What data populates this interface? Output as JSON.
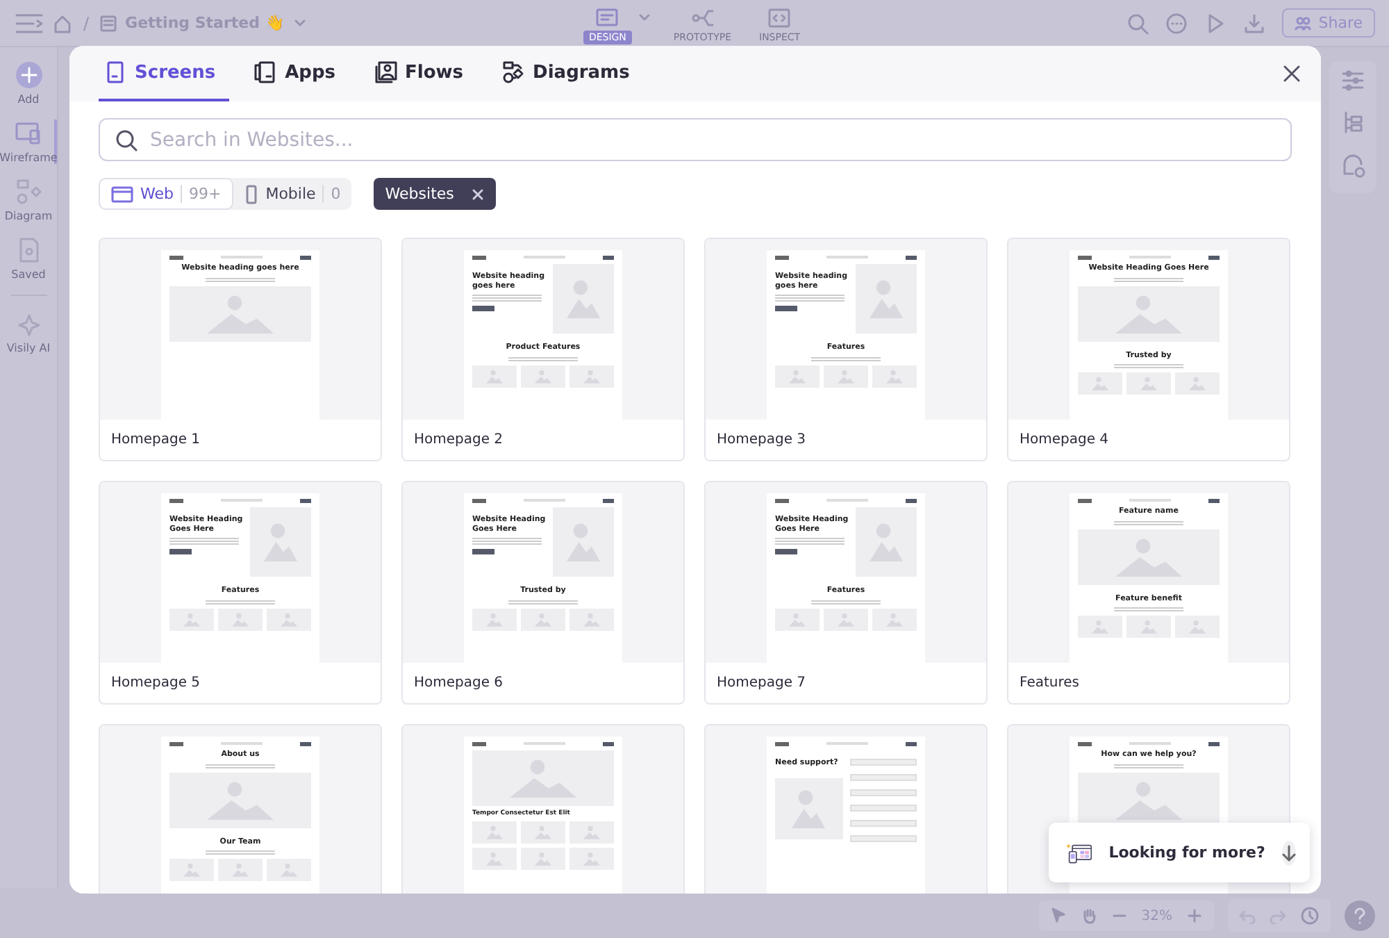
{
  "app": {
    "breadcrumb_separator": "/",
    "breadcrumb": "Getting Started 👋",
    "modes": [
      {
        "label": "DESIGN",
        "selected": true
      },
      {
        "label": "PROTOTYPE",
        "selected": false
      },
      {
        "label": "INSPECT",
        "selected": false
      }
    ],
    "share": "Share",
    "sidebar": [
      {
        "label": "Add",
        "kind": "add",
        "selected": false
      },
      {
        "label": "Wireframe",
        "kind": "wireframe",
        "selected": true
      },
      {
        "label": "Diagram",
        "kind": "diagram",
        "selected": false
      },
      {
        "label": "Saved",
        "kind": "saved",
        "selected": false
      },
      {
        "label": "Visily AI",
        "kind": "ai",
        "selected": false
      }
    ],
    "zoom": "32%"
  },
  "modal": {
    "tabs": [
      {
        "label": "Screens",
        "selected": true
      },
      {
        "label": "Apps",
        "selected": false
      },
      {
        "label": "Flows",
        "selected": false
      },
      {
        "label": "Diagrams",
        "selected": false
      }
    ],
    "search": {
      "placeholder": "Search in Websites..."
    },
    "platforms": [
      {
        "label": "Web",
        "count": "99+",
        "selected": true
      },
      {
        "label": "Mobile",
        "count": "0",
        "selected": false
      }
    ],
    "filter": {
      "label": "Websites"
    },
    "templates": [
      {
        "name": "Homepage 1",
        "kind": "center",
        "headings": [
          "Website heading goes here"
        ]
      },
      {
        "name": "Homepage 2",
        "kind": "split",
        "headings": [
          "Website heading goes here",
          "Product Features"
        ]
      },
      {
        "name": "Homepage 3",
        "kind": "split",
        "headings": [
          "Website heading goes here",
          "Features"
        ]
      },
      {
        "name": "Homepage 4",
        "kind": "center",
        "headings": [
          "Website Heading Goes Here",
          "Trusted by"
        ]
      },
      {
        "name": "Homepage 5",
        "kind": "split",
        "headings": [
          "Website Heading Goes Here",
          "Features"
        ]
      },
      {
        "name": "Homepage 6",
        "kind": "split",
        "headings": [
          "Website Heading Goes Here",
          "Trusted by"
        ]
      },
      {
        "name": "Homepage 7",
        "kind": "split",
        "headings": [
          "Website Heading Goes Here",
          "Features"
        ]
      },
      {
        "name": "Features",
        "kind": "center",
        "headings": [
          "Feature name",
          "Feature benefit"
        ]
      },
      {
        "kind": "center",
        "headings": [
          "About us",
          "Our Team"
        ]
      },
      {
        "kind": "image",
        "headings": [
          "Tempor Consectetur Est Elit"
        ]
      },
      {
        "kind": "form",
        "headings": [
          "Need support?"
        ]
      },
      {
        "kind": "center",
        "headings": [
          "How can we help you?"
        ]
      }
    ],
    "promo": {
      "text": "Looking for more?"
    }
  }
}
